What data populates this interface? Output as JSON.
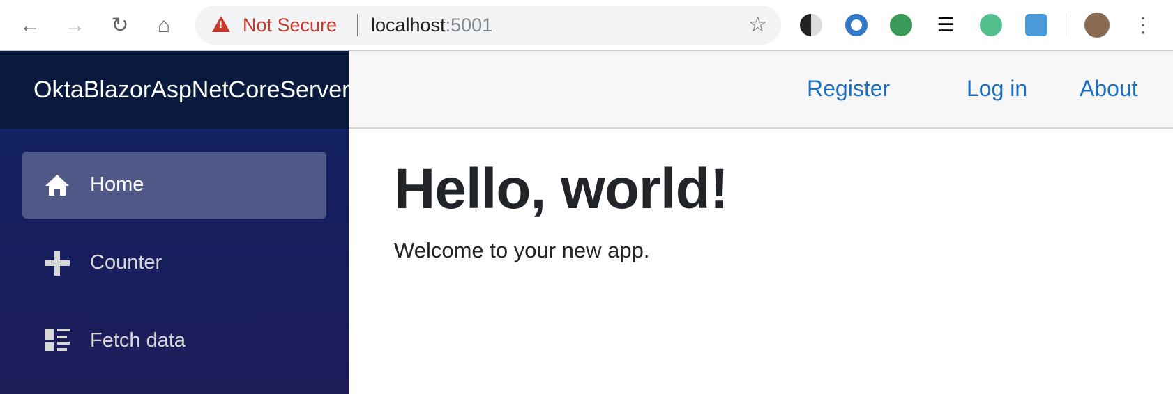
{
  "browser": {
    "security_label": "Not Secure",
    "url_host": "localhost",
    "url_port": ":5001",
    "icons": [
      "back-icon",
      "forward-icon",
      "reload-icon",
      "home-icon",
      "bookmark-star-icon",
      "menu-icon"
    ]
  },
  "app": {
    "brand": "OktaBlazorAspNetCoreServer"
  },
  "top_nav": {
    "register": "Register",
    "login": "Log in",
    "about": "About"
  },
  "sidebar": {
    "items": [
      {
        "label": "Home",
        "icon": "home-icon",
        "active": true
      },
      {
        "label": "Counter",
        "icon": "plus-icon",
        "active": false
      },
      {
        "label": "Fetch data",
        "icon": "list-icon",
        "active": false
      }
    ]
  },
  "main": {
    "title": "Hello, world!",
    "text": "Welcome to your new app."
  },
  "colors": {
    "link": "#1b6ec2",
    "sidebar_top": "#0f2262",
    "sidebar_bottom": "#1e1c59",
    "warning": "#c5392b"
  }
}
